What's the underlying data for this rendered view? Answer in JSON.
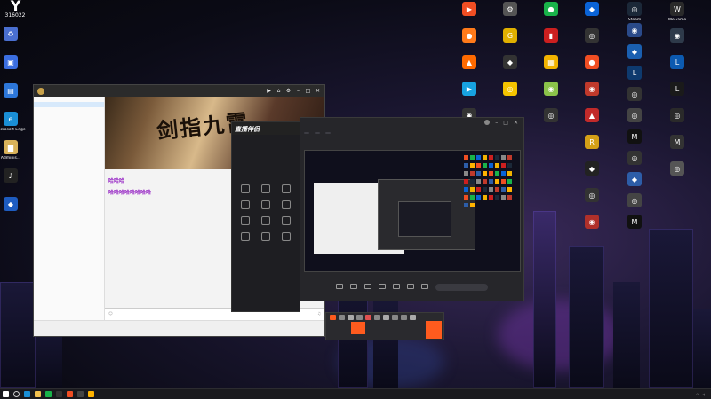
{
  "desktop": {
    "user_badge": {
      "logo": "Y",
      "number": "316022"
    },
    "left_icons": [
      {
        "label": "",
        "icon": "bin-icon",
        "color": "#4a6fd0",
        "glyph": "♻"
      },
      {
        "label": "",
        "icon": "computer-icon",
        "color": "#3b6ee0",
        "glyph": "▣"
      },
      {
        "label": "",
        "icon": "computer-icon",
        "color": "#2d77d9",
        "glyph": "▤"
      },
      {
        "label": "Microsoft Edge",
        "icon": "edge-icon",
        "color": "#1a8fd6",
        "glyph": "e"
      },
      {
        "label": "Adminis...",
        "icon": "folder-user-icon",
        "color": "#d8b25a",
        "glyph": "▆"
      },
      {
        "label": "",
        "icon": "music-app-icon",
        "color": "#222",
        "glyph": "♪"
      },
      {
        "label": "",
        "icon": "app-icon",
        "color": "#1e5cc0",
        "glyph": "◆"
      }
    ],
    "right_icons_col1": [
      {
        "label": "",
        "color": "#f04e23",
        "glyph": "▶"
      },
      {
        "label": "",
        "color": "#ff7a1a",
        "glyph": "●"
      },
      {
        "label": "",
        "color": "#ff6a00",
        "glyph": "▲"
      },
      {
        "label": "",
        "color": "#17a2e0",
        "glyph": "▶"
      },
      {
        "label": "",
        "color": "#333",
        "glyph": "◉"
      }
    ],
    "right_icons_col2": [
      {
        "label": "",
        "color": "#555",
        "glyph": "⚙"
      },
      {
        "label": "",
        "color": "#e0b000",
        "glyph": "G"
      },
      {
        "label": "",
        "color": "#333",
        "glyph": "◆"
      },
      {
        "label": "",
        "color": "#f5c400",
        "glyph": "◎"
      }
    ],
    "right_icons_col3": [
      {
        "label": "",
        "color": "#19b34a",
        "glyph": "●"
      },
      {
        "label": "",
        "color": "#cc1f1f",
        "glyph": "▮"
      },
      {
        "label": "",
        "color": "#f2b300",
        "glyph": "▦"
      },
      {
        "label": "",
        "color": "#8bc34a",
        "glyph": "◉"
      },
      {
        "label": "",
        "color": "#333",
        "glyph": "◎"
      }
    ],
    "right_icons_col4": [
      {
        "label": "",
        "color": "#0a63d6",
        "glyph": "◆"
      },
      {
        "label": "",
        "color": "#333",
        "glyph": "◎"
      },
      {
        "label": "",
        "color": "#f04e23",
        "glyph": "●"
      },
      {
        "label": "",
        "color": "#c0392b",
        "glyph": "◉"
      },
      {
        "label": "",
        "color": "#c12a2a",
        "glyph": "▲"
      },
      {
        "label": "",
        "color": "#d4a017",
        "glyph": "R"
      },
      {
        "label": "",
        "color": "#222",
        "glyph": "◆"
      },
      {
        "label": "",
        "color": "#333",
        "glyph": "◎"
      },
      {
        "label": "",
        "color": "#b0302a",
        "glyph": "◉"
      }
    ],
    "right_icons_col5": [
      {
        "label": "Steam",
        "color": "#1b2838",
        "glyph": "◎"
      },
      {
        "label": "",
        "color": "#2a4a8a",
        "glyph": "◉"
      },
      {
        "label": "",
        "color": "#1a5fb0",
        "glyph": "◆"
      },
      {
        "label": "",
        "color": "#0e3a6e",
        "glyph": "L"
      },
      {
        "label": "",
        "color": "#333",
        "glyph": "◎"
      },
      {
        "label": "",
        "color": "#444",
        "glyph": "◎"
      },
      {
        "label": "",
        "color": "#111",
        "glyph": "M"
      },
      {
        "label": "",
        "color": "#333",
        "glyph": "◎"
      },
      {
        "label": "",
        "color": "#2d5da8",
        "glyph": "◆"
      },
      {
        "label": "",
        "color": "#444",
        "glyph": "◎"
      },
      {
        "label": "",
        "color": "#111",
        "glyph": "M"
      }
    ],
    "right_icons_col6": [
      {
        "label": "WeGame",
        "color": "#2a2a2a",
        "glyph": "W"
      },
      {
        "label": "",
        "color": "#2e3a4a",
        "glyph": "◉"
      },
      {
        "label": "",
        "color": "#0c5ab0",
        "glyph": "L"
      },
      {
        "label": "",
        "color": "#1a1a1a",
        "glyph": "L"
      },
      {
        "label": "",
        "color": "#2a2a2a",
        "glyph": "◎"
      },
      {
        "label": "",
        "color": "#333",
        "glyph": "M"
      },
      {
        "label": "",
        "color": "#555",
        "glyph": "◎"
      }
    ]
  },
  "chat_window": {
    "title": "",
    "sidebar_rows": [
      "",
      "",
      "",
      "",
      "",
      "",
      "",
      "",
      "",
      "",
      "",
      "",
      "",
      "",
      "",
      "",
      "",
      "",
      "",
      "",
      "",
      "",
      "",
      "",
      "",
      "",
      "",
      "",
      "",
      "",
      "",
      "",
      "",
      "",
      "",
      "",
      "",
      "",
      "",
      "",
      "",
      "",
      ""
    ],
    "banner_text": "剑指九霄",
    "messages": [
      {
        "meta": "",
        "text": "",
        "purple": false
      },
      {
        "meta": "",
        "text": "哈哈哈",
        "purple": true
      },
      {
        "meta": "",
        "text": "哈哈哈哈哈哈哈哈",
        "purple": true
      },
      {
        "meta": "",
        "text": "",
        "purple": false
      },
      {
        "meta": "",
        "text": "",
        "purple": false
      },
      {
        "meta": "",
        "text": "",
        "purple": false
      },
      {
        "meta": "",
        "text": "",
        "purple": false
      },
      {
        "meta": "",
        "text": "",
        "purple": false
      }
    ],
    "input_placeholder": "",
    "footer_items": [
      "",
      "",
      ""
    ],
    "send_label": ""
  },
  "live_panel": {
    "logo": "直播伴侣",
    "tabs": [
      "",
      "",
      ""
    ],
    "tool_header": "",
    "grid_cells": [
      "",
      "",
      "",
      "",
      "",
      "",
      "",
      "",
      "",
      "",
      "",
      ""
    ],
    "status": ""
  },
  "stream_window": {
    "pills": [
      "",
      "",
      ""
    ],
    "tools": [
      "",
      "",
      "",
      "",
      "",
      "",
      ""
    ],
    "input_placeholder": ""
  },
  "bottom_bar": {
    "orange_label": "",
    "text": "",
    "button_label": ""
  },
  "taskbar": {
    "items": [
      {
        "icon": "windows-icon",
        "color": "#ffffff"
      },
      {
        "icon": "task-view-icon",
        "color": "#aaa"
      },
      {
        "icon": "edge-icon",
        "color": "#1a8fd6"
      },
      {
        "icon": "explorer-icon",
        "color": "#f2c14e"
      },
      {
        "icon": "chat-icon",
        "color": "#19b34a"
      },
      {
        "icon": "app-icon",
        "color": "#333"
      },
      {
        "icon": "app-icon",
        "color": "#f04e23"
      },
      {
        "icon": "app-icon",
        "color": "#444"
      },
      {
        "icon": "app-icon",
        "color": "#ffb300"
      }
    ],
    "time": "",
    "date": ""
  }
}
